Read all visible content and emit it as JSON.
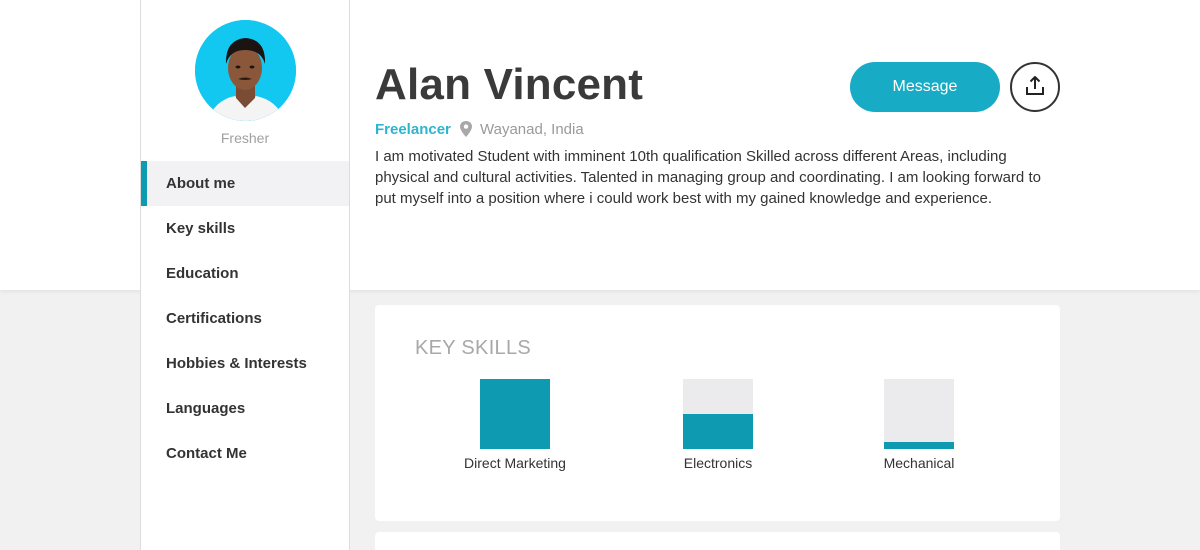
{
  "profile": {
    "status": "Fresher",
    "name": "Alan Vincent",
    "role": "Freelancer",
    "location": "Wayanad, India",
    "about": "I am motivated Student with imminent 10th qualification Skilled across different Areas, including physical and cultural activities. Talented in managing group and coordinating. I am looking forward to put myself into a position where i could work best with my gained knowledge and experience."
  },
  "actions": {
    "message_label": "Message",
    "share_icon": "share-upload-icon"
  },
  "nav": {
    "items": [
      {
        "label": "About me",
        "active": true
      },
      {
        "label": "Key skills"
      },
      {
        "label": "Education"
      },
      {
        "label": "Certifications"
      },
      {
        "label": "Hobbies & Interests"
      },
      {
        "label": "Languages"
      },
      {
        "label": "Contact Me"
      }
    ]
  },
  "skills": {
    "title": "KEY SKILLS",
    "items": [
      {
        "label": "Direct Marketing",
        "level": 1.0
      },
      {
        "label": "Electronics",
        "level": 0.5
      },
      {
        "label": "Mechanical",
        "level": 0.1
      }
    ]
  },
  "colors": {
    "accent": "#0e9ab0",
    "button": "#17abc6",
    "avatar_bg": "#13c8f0"
  }
}
